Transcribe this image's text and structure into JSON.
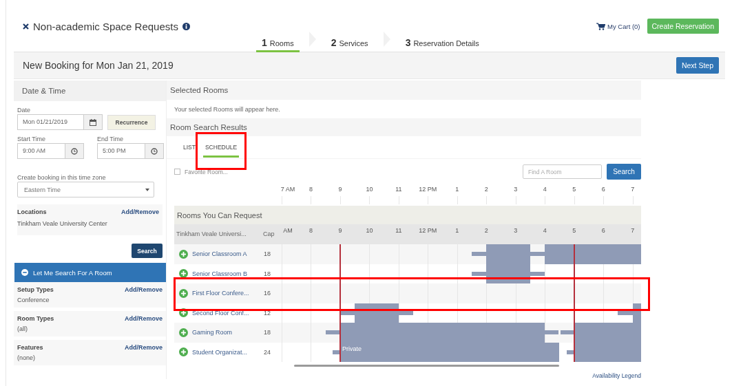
{
  "header": {
    "title": "Non-academic Space Requests",
    "cart": "My Cart (0)",
    "create_button": "Create Reservation"
  },
  "steps": [
    {
      "number": "1",
      "label": "Rooms",
      "selected": true
    },
    {
      "number": "2",
      "label": "Services",
      "selected": false
    },
    {
      "number": "3",
      "label": "Reservation Details",
      "selected": false
    }
  ],
  "toolbar": {
    "title": "New Booking for Mon Jan 21, 2019",
    "next_button": "Next Step"
  },
  "sidebar": {
    "heading": "Date & Time",
    "date": {
      "label": "Date",
      "value": "Mon 01/21/2019"
    },
    "recurrence_button": "Recurrence",
    "start_time": {
      "label": "Start Time",
      "value": "9:00 AM"
    },
    "end_time": {
      "label": "End Time",
      "value": "5:00 PM"
    },
    "timezone": {
      "label": "Create booking in this time zone",
      "value": "Eastern Time"
    },
    "locations": {
      "label": "Locations",
      "link": "Add/Remove",
      "value": "Tinkham Veale University Center"
    },
    "search_button": "Search",
    "search_panel": {
      "title": "Let Me Search For A Room",
      "expanded": true
    },
    "filters": [
      {
        "label": "Setup Types",
        "link": "Add/Remove",
        "value": "Conference"
      },
      {
        "label": "Room Types",
        "link": "Add/Remove",
        "value": "(all)"
      },
      {
        "label": "Features",
        "link": "Add/Remove",
        "value": "(none)"
      }
    ]
  },
  "selected_rooms": {
    "heading": "Selected Rooms",
    "message": "Your selected Rooms will appear here."
  },
  "results": {
    "heading": "Room Search Results",
    "view_tabs": [
      {
        "label": "LIST",
        "selected": false,
        "highlighted": false
      },
      {
        "label": "SCHEDULE",
        "selected": true,
        "highlighted": true
      }
    ],
    "favorite": {
      "label": "Favorite Room...",
      "checked": false
    },
    "find_field": {
      "placeholder": "Find A Room"
    },
    "search_button": "Search"
  },
  "schedule": {
    "hours": [
      "7 AM",
      "8",
      "9",
      "10",
      "11",
      "12 PM",
      "1",
      "2",
      "3",
      "4",
      "5",
      "6",
      "7"
    ],
    "group": "Rooms You Can Request",
    "columns": [
      "Tinkham Veale Universi...",
      "Cap"
    ],
    "header_hours": [
      "AM",
      "8",
      "9",
      "10",
      "11",
      "12 PM",
      "1",
      "2",
      "3",
      "4",
      "5",
      "6",
      "7"
    ],
    "rooms": [
      {
        "name": "Senior Classroom A",
        "capacity": "18",
        "highlighted": false
      },
      {
        "name": "Senior Classroom B",
        "capacity": "18",
        "highlighted": false
      },
      {
        "name": "First Floor Confere...",
        "capacity": "16",
        "highlighted": true
      },
      {
        "name": "Second Floor Conf...",
        "capacity": "12",
        "highlighted": false
      },
      {
        "name": "Gaming Room",
        "capacity": "18",
        "highlighted": false
      },
      {
        "name": "Student Organizat...",
        "capacity": "24",
        "highlighted": false,
        "booking_label": "Private"
      }
    ],
    "legend_link": "Availability Legend"
  }
}
